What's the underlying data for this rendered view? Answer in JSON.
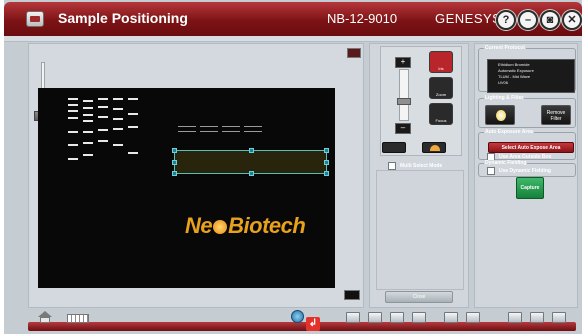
{
  "app": {
    "title": "Sample Positioning",
    "instrument_model": "NB-12-9010",
    "brand": "GENESYS",
    "window_controls": [
      {
        "name": "help",
        "glyph": "?"
      },
      {
        "name": "minimize",
        "glyph": "–"
      },
      {
        "name": "restore",
        "glyph": "◙"
      },
      {
        "name": "close",
        "glyph": "✕"
      }
    ]
  },
  "preview": {
    "watermark": {
      "part1": "Ne",
      "part2": "Biotech"
    },
    "multi_select_label": "Multi Select Mode",
    "close_label": "Close"
  },
  "camera_tools": {
    "slider_up_glyph": "+",
    "slider_down_glyph": "–",
    "buttons": [
      {
        "id": "iris",
        "label": "Iris",
        "color": "#b8262b"
      },
      {
        "id": "zoom",
        "label": "Zoom",
        "color": "#2a2a2a"
      },
      {
        "id": "focus",
        "label": "Focus",
        "color": "#2a2a2a"
      }
    ]
  },
  "protocol": {
    "title": "Current Protocol",
    "items": [
      "Ethidium Bromide",
      "Automatic Exposure",
      "TLUM - Mid Wave",
      "UV06"
    ]
  },
  "lighting": {
    "title": "Lighting & Filter",
    "remove_filter_label": "Remove Filter"
  },
  "exposure": {
    "title": "Auto Exposure Area",
    "select_button": "Select Auto Expose Area",
    "use_outside_box": "Use Area Outside Box"
  },
  "dynamic_fielding": {
    "title": "Dynamic Fielding",
    "use_dynamic": "Use Dynamic Fielding"
  },
  "capture_label": "Capture"
}
